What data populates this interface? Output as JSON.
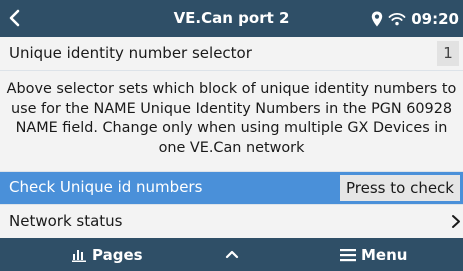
{
  "header": {
    "title": "VE.Can port 2",
    "time": "09:20",
    "icons": [
      "back-icon",
      "location-pin-icon",
      "wifi-icon"
    ]
  },
  "rows": {
    "selector": {
      "label": "Unique identity number selector",
      "value": "1"
    },
    "info": {
      "text": "Above selector sets which block of unique identity numbers to use for the NAME Unique Identity Numbers in the PGN 60928 NAME field. Change only when using multiple GX Devices in one VE.Can network"
    },
    "check": {
      "label": "Check Unique id numbers",
      "button": "Press to check"
    },
    "network": {
      "label": "Network status"
    }
  },
  "footer": {
    "pages_label": "Pages",
    "menu_label": "Menu",
    "icons": [
      "pages-chart-icon",
      "chevron-up-icon",
      "hamburger-menu-icon"
    ]
  },
  "colors": {
    "bar": "#2f4f67",
    "selected_row": "#4a90d9",
    "row_bg": "#f3f3f3",
    "page_bg": "#dde3e9"
  }
}
